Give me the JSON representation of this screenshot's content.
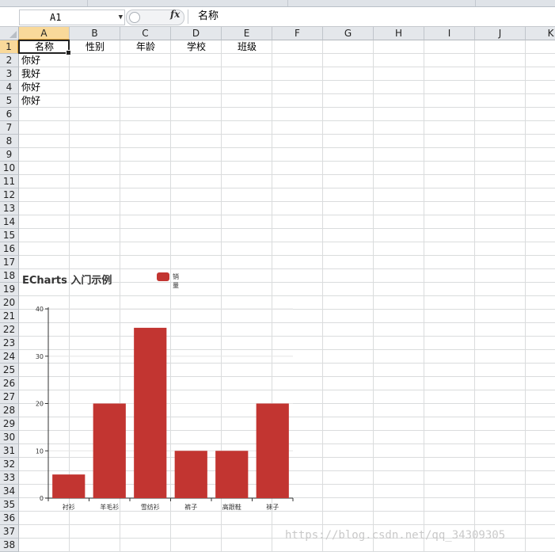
{
  "formula_bar": {
    "name_box": "A1",
    "fx_symbol": "fx",
    "formula": "名称"
  },
  "columns": [
    "A",
    "B",
    "C",
    "D",
    "E",
    "F",
    "G",
    "H",
    "I",
    "J",
    "K"
  ],
  "selected_column": "A",
  "rows": [
    "1",
    "2",
    "3",
    "4",
    "5",
    "6",
    "7",
    "8",
    "9",
    "10",
    "11",
    "12",
    "13",
    "14",
    "15",
    "16",
    "17",
    "18",
    "19",
    "20",
    "21",
    "22",
    "23",
    "24",
    "25",
    "26",
    "27",
    "28",
    "29",
    "30",
    "31",
    "32",
    "33",
    "34",
    "35",
    "36",
    "37",
    "38"
  ],
  "selected_row": "1",
  "header_row": [
    "名称",
    "性别",
    "年龄",
    "学校",
    "班级"
  ],
  "column_a_values": [
    "你好",
    "我好",
    "你好",
    "你好"
  ],
  "colors": {
    "bar": "#c23531",
    "selection": "#f9d99a"
  },
  "chart": {
    "title": "ECharts 入门示例",
    "legend": "销量"
  },
  "chart_data": {
    "type": "bar",
    "title": "ECharts 入门示例",
    "categories": [
      "衬衫",
      "羊毛衫",
      "雪纺衫",
      "裤子",
      "高跟鞋",
      "袜子"
    ],
    "series": [
      {
        "name": "销量",
        "values": [
          5,
          20,
          36,
          10,
          10,
          20
        ]
      }
    ],
    "yticks": [
      "0",
      "10",
      "20",
      "30",
      "40"
    ],
    "ylim": [
      0,
      40
    ],
    "legend_position": "top-center",
    "grid": true
  },
  "watermark": "https://blog.csdn.net/qq_34309305"
}
